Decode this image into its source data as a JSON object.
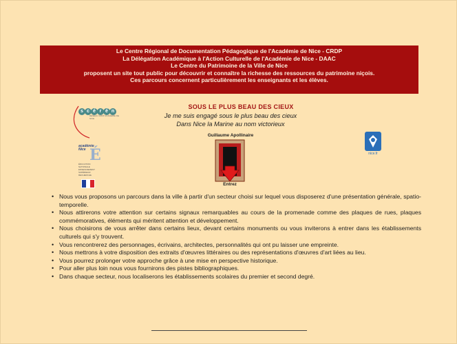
{
  "banner": {
    "line1": "Le Centre Régional de Documentation Pédagogique de l'Académie de Nice - CRDP",
    "line2": "La Délégation Académique à l'Action Culturelle de l'Académie de Nice - DAAC",
    "line3": "Le Centre du Patrimoine de la Ville de Nice",
    "line4": "proposent un site tout public pour découvrir et connaître la richesse des ressources du patrimoine niçois.",
    "line5": "Ces parcours concernent particulièrement les enseignants et les élèves."
  },
  "logos": {
    "crdp_circles": [
      "s",
      "c",
      "é",
      "r",
      "é",
      "n"
    ],
    "crdp_fine": "RÉSEAU CRDP ACADÉMIE DE NICE",
    "academie_label": "académie\nNice",
    "academie_letter": "É",
    "academie_fine": "ÉDUCATION NATIONALE ENSEIGNEMENT SUPÉRIEUR RECHERCHE",
    "nice_label": "nice.fr"
  },
  "title": "SOUS LE PLUS BEAU DES CIEUX",
  "poem": {
    "line1": "Je me suis engagé sous le plus beau des cieux",
    "line2": "Dans Nice la Marine au nom victorieux",
    "author": "Guillaume Apollinaire"
  },
  "enter_label": "Entrez",
  "bullets": [
    "Nous vous proposons un parcours dans la ville à partir d'un secteur choisi sur lequel vous disposerez d'une présentation générale, spatio-temporelle.",
    "Nous attirerons votre attention sur certains signaux remarquables au cours de la promenade comme des plaques de rues, plaques commémoratives, éléments qui méritent attention et développement.",
    "Nous choisirons de vous arrêter dans certains lieux, devant certains monuments ou vous inviterons à entrer dans les établissements culturels qui s'y trouvent.",
    "Vous rencontrerez des personnages, écrivains, architectes, personnalités qui ont pu laisser une empreinte.",
    "Nous mettrons à votre disposition des extraits d'œuvres littéraires ou des représentations d'œuvres d'art liées au lieu.",
    "Vous pourrez prolonger votre approche grâce à une mise en perspective historique.",
    "Pour aller plus loin nous vous fournirons des pistes bibliographiques.",
    "Dans chaque secteur, nous localiserons les établissements scolaires du premier et second degré."
  ],
  "colors": {
    "background": "#fde3b2",
    "banner": "#a50d0d",
    "title": "#a31515",
    "arrow": "#d8181b"
  }
}
